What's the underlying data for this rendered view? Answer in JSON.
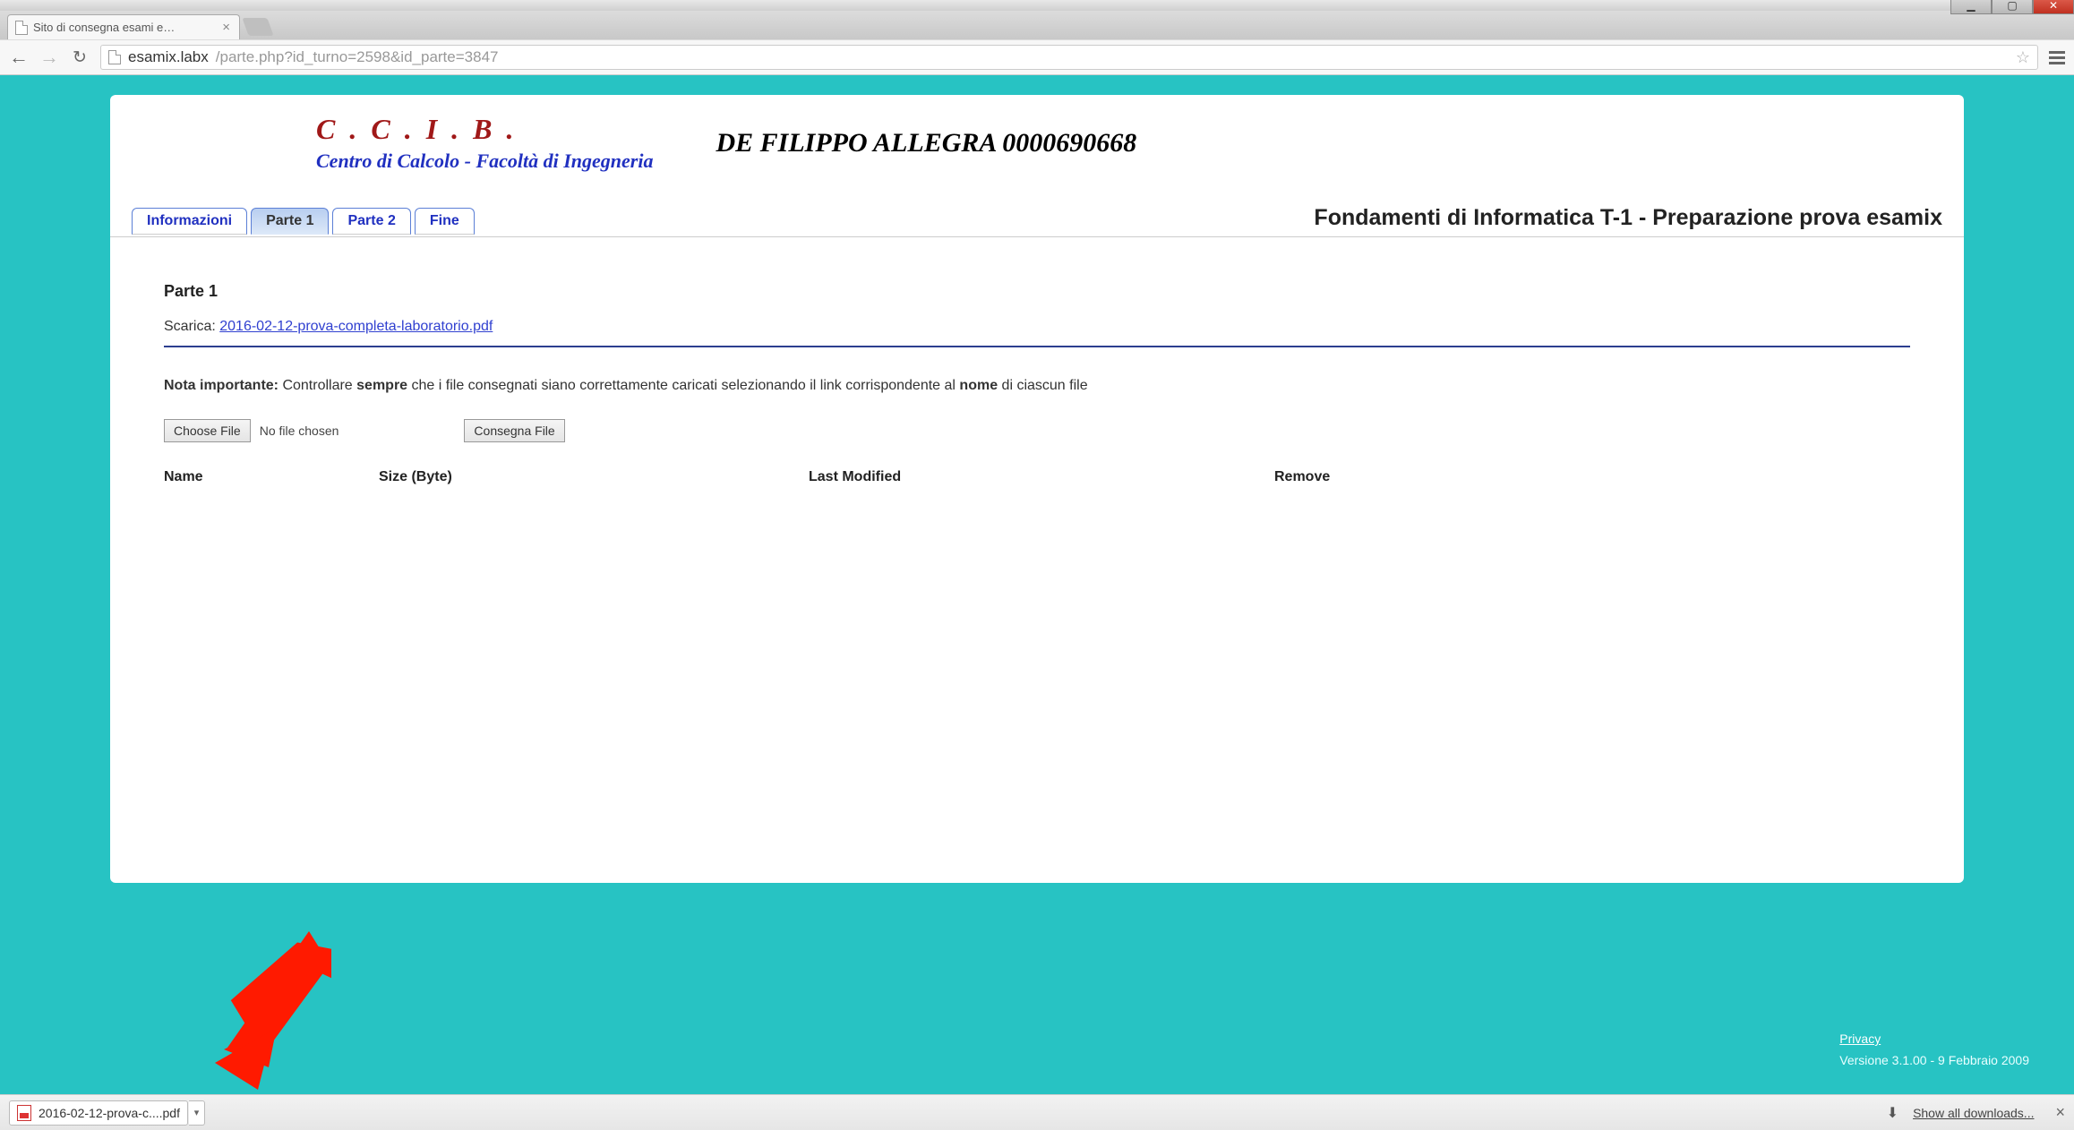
{
  "window": {
    "tab_title": "Sito di consegna esami e…"
  },
  "browser": {
    "url_domain": "esamix.labx",
    "url_path": "/parte.php?id_turno=2598&id_parte=3847"
  },
  "header": {
    "ccib_title": "C . C . I . B .",
    "ccib_sub": "Centro di Calcolo - Facoltà di Ingegneria",
    "student": "DE FILIPPO ALLEGRA 0000690668"
  },
  "tabs": {
    "items": [
      "Informazioni",
      "Parte 1",
      "Parte 2",
      "Fine"
    ],
    "active_index": 1,
    "course_title": "Fondamenti di Informatica T-1 - Preparazione prova esamix"
  },
  "content": {
    "section_title": "Parte 1",
    "download_label": "Scarica:",
    "download_filename": "2016-02-12-prova-completa-laboratorio.pdf",
    "note_prefix": "Nota importante:",
    "note_text_1": " Controllare ",
    "note_strong_1": "sempre",
    "note_text_2": " che i file consegnati siano correttamente caricati selezionando il link corrispondente al ",
    "note_strong_2": "nome",
    "note_text_3": " di ciascun file",
    "choose_file_label": "Choose File",
    "no_file_text": "No file chosen",
    "submit_label": "Consegna File",
    "columns": {
      "name": "Name",
      "size": "Size (Byte)",
      "modified": "Last Modified",
      "remove": "Remove"
    }
  },
  "footer": {
    "privacy": "Privacy",
    "version": "Versione 3.1.00 - 9 Febbraio 2009"
  },
  "download_shelf": {
    "file": "2016-02-12-prova-c....pdf",
    "show_all": "Show all downloads..."
  }
}
